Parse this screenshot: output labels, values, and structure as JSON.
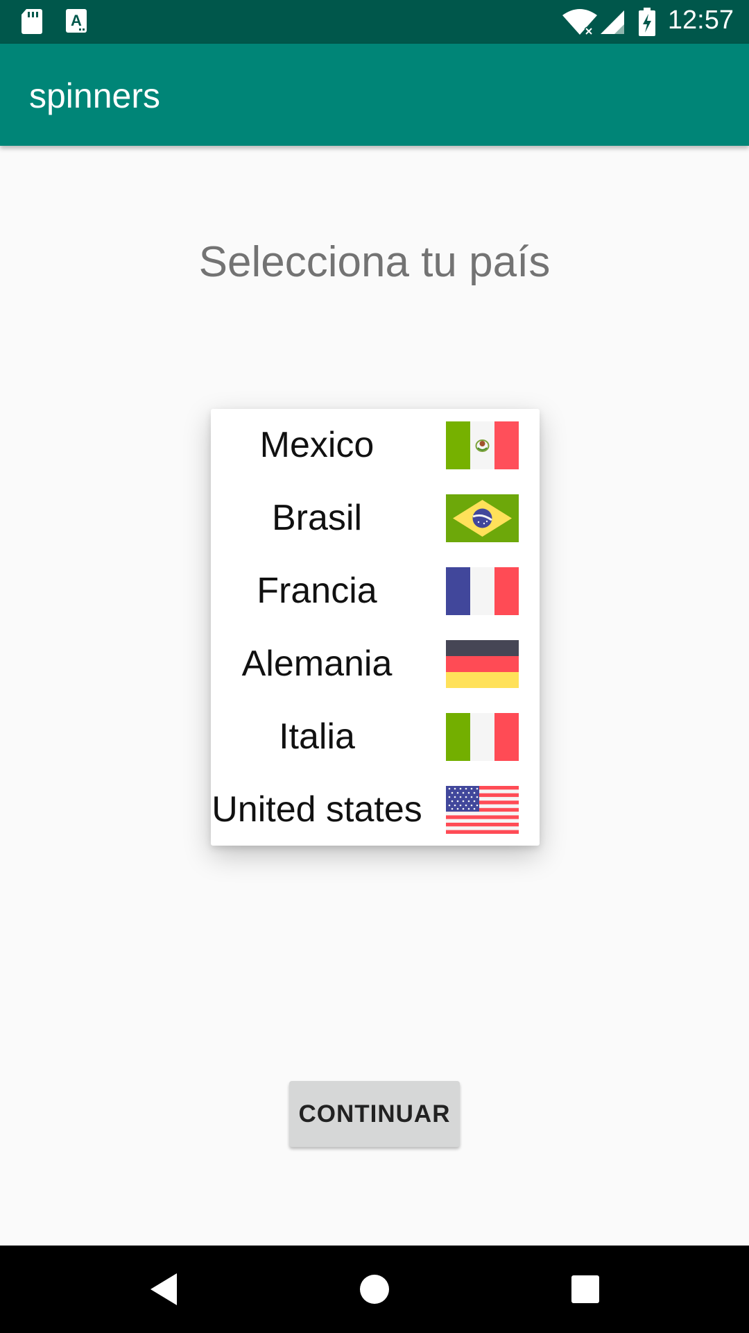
{
  "status_bar": {
    "time": "12:57",
    "icons": [
      "sd-card-icon",
      "keyboard-a-icon",
      "wifi-icon",
      "signal-icon",
      "battery-charging-icon"
    ],
    "background": "#00574b"
  },
  "app_bar": {
    "title": "spinners",
    "background": "#008577"
  },
  "heading": "Selecciona tu país",
  "countries": [
    {
      "label": "Mexico",
      "flag": "mexico-flag-icon"
    },
    {
      "label": "Brasil",
      "flag": "brazil-flag-icon"
    },
    {
      "label": "Francia",
      "flag": "france-flag-icon"
    },
    {
      "label": "Alemania",
      "flag": "germany-flag-icon"
    },
    {
      "label": "Italia",
      "flag": "italy-flag-icon"
    },
    {
      "label": "United states",
      "flag": "usa-flag-icon"
    }
  ],
  "continue_button": "CONTINUAR",
  "nav_bar": {
    "buttons": [
      "back-icon",
      "home-icon",
      "recents-icon"
    ]
  }
}
